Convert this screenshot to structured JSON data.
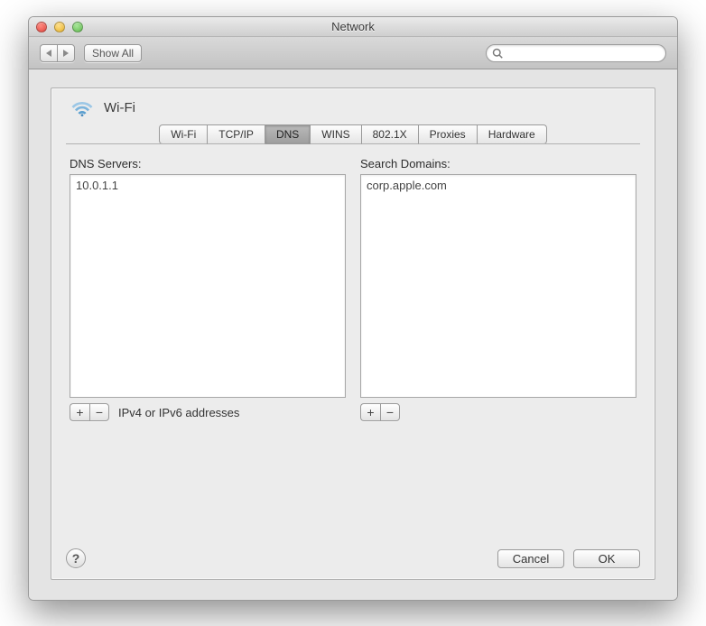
{
  "window": {
    "title": "Network"
  },
  "toolbar": {
    "show_all": "Show All",
    "search_placeholder": ""
  },
  "connection": {
    "name": "Wi-Fi"
  },
  "tabs": {
    "wifi": "Wi-Fi",
    "tcpip": "TCP/IP",
    "dns": "DNS",
    "wins": "WINS",
    "8021x": "802.1X",
    "proxies": "Proxies",
    "hardware": "Hardware",
    "active": "dns"
  },
  "dns": {
    "servers_label": "DNS Servers:",
    "servers": [
      "10.0.1.1"
    ],
    "domains_label": "Search Domains:",
    "domains": [
      "corp.apple.com"
    ],
    "hint": "IPv4 or IPv6 addresses"
  },
  "buttons": {
    "cancel": "Cancel",
    "ok": "OK",
    "plus": "+",
    "minus": "−",
    "help": "?"
  }
}
